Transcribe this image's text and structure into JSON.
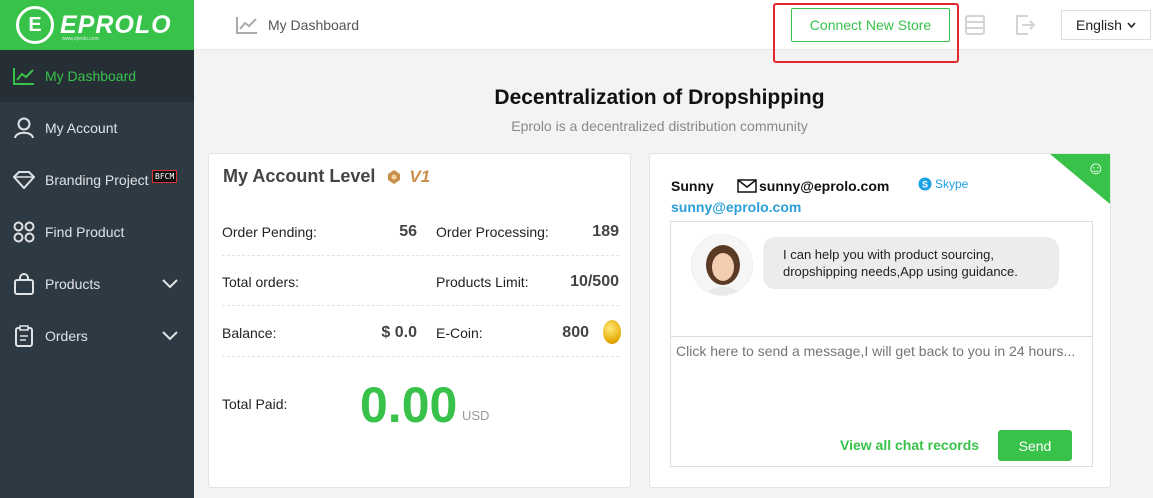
{
  "brand": {
    "name": "EPROLO",
    "mark": "E",
    "sub": "www.eprolo.com"
  },
  "sidebar": {
    "items": [
      {
        "label": "My Dashboard",
        "icon": "chart-line-icon",
        "active": true
      },
      {
        "label": "My Account",
        "icon": "user-icon"
      },
      {
        "label": "Branding Project",
        "icon": "diamond-icon",
        "badge": "BFCM"
      },
      {
        "label": "Find Product",
        "icon": "grid-icon"
      },
      {
        "label": "Products",
        "icon": "bag-icon",
        "expandable": true
      },
      {
        "label": "Orders",
        "icon": "clipboard-icon",
        "expandable": true
      }
    ]
  },
  "header": {
    "breadcrumb": "My Dashboard",
    "connect_label": "Connect New Store",
    "language": "English"
  },
  "hero": {
    "title": "Decentralization of Dropshipping",
    "subtitle": "Eprolo is a decentralized distribution community"
  },
  "account": {
    "title": "My Account Level",
    "level_text": "V1",
    "order_pending_label": "Order Pending:",
    "order_pending": "56",
    "order_processing_label": "Order Processing:",
    "order_processing": "189",
    "total_orders_label": "Total orders:",
    "total_orders": "",
    "products_limit_label": "Products Limit:",
    "products_limit": "10/500",
    "balance_label": "Balance:",
    "balance": "$ 0.0",
    "ecoin_label": "E-Coin:",
    "ecoin": "800",
    "total_paid_label": "Total Paid:",
    "total_paid": "0.00",
    "total_paid_unit": "USD"
  },
  "chat": {
    "agent_name": "Sunny",
    "agent_email": "sunny@eprolo.com",
    "skype_label": "Skype",
    "agent_link": "sunny@eprolo.com",
    "message": "I can help you with product sourcing, dropshipping needs,App using guidance.",
    "input_placeholder": "Click here to send a message,I will get back to you in 24 hours...",
    "view_all_label": "View all chat records",
    "send_label": "Send"
  },
  "colors": {
    "accent": "#38c24a",
    "sidebar": "#2e3a43",
    "highlight": "#e0282c",
    "link": "#2a9fd8"
  }
}
